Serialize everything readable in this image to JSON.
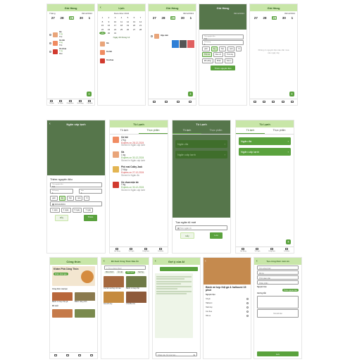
{
  "s1": {
    "title": "Giỏ Hàng",
    "week_label": "Tháng",
    "date": "09/12/2024",
    "days": [
      "27",
      "28",
      "29",
      "30",
      "1"
    ],
    "items": [
      {
        "name": "Gà",
        "qty": "1 kg",
        "note": "Thịt"
      },
      {
        "name": "Cá hồi",
        "qty": "2 kg",
        "note": "Thịt"
      },
      {
        "name": "Cà chua",
        "qty": "1 kg",
        "note": "Rau"
      }
    ],
    "nav": [
      "Tủ lạnh",
      "Tủ Lạnh",
      "Công thức",
      "Giỏ hàng",
      "Cá nhân"
    ],
    "fab": "+"
  },
  "s2": {
    "title": "Lịch",
    "month": "December 2024",
    "cal_days": [
      "1",
      "2",
      "3",
      "4",
      "5",
      "6",
      "7",
      "8",
      "9",
      "10",
      "11",
      "12",
      "13",
      "14",
      "15",
      "16",
      "17",
      "18",
      "19",
      "20",
      "21",
      "22",
      "23",
      "24",
      "25",
      "26",
      "27",
      "28",
      "29",
      "30",
      "31"
    ],
    "selected": "29",
    "sub": "Ngày 29 tháng 12",
    "items": [
      {
        "name": "Gà"
      },
      {
        "name": "Cá hồi"
      },
      {
        "name": "Cà chua"
      }
    ]
  },
  "s3": {
    "title": "Giỏ Hàng",
    "date": "09/12/2024",
    "days": [
      "27",
      "28",
      "29",
      "30",
      "1"
    ],
    "row_label": "Hộp cảm",
    "options": [
      "Hủy",
      "Sửa",
      "Xóa"
    ]
  },
  "s4": {
    "title": "Giỏ Hàng",
    "date": "09/12/2024",
    "fields": [
      {
        "label": "Tên nguyên liệu",
        "value": "Gà"
      },
      {
        "label": "Số lượng",
        "value": "1"
      }
    ],
    "units": [
      "gam",
      "kg",
      "hộp",
      "quả",
      "lít"
    ],
    "tags": [
      "Thịt cá",
      "Rau củ",
      "Trái cây",
      "Đồ uống",
      "Khác",
      "Gia vị"
    ],
    "submit": "Thêm nguyên liệu"
  },
  "s5": {
    "title": "Giỏ Hàng",
    "date": "09/12/2024",
    "days": [
      "27",
      "28",
      "29",
      "30",
      "1"
    ],
    "empty": "Không có nguyên liệu nào cần mua vào ngày này"
  },
  "m1": {
    "title": "Ngăn cấp lạnh",
    "sheet_title": "Thêm nguyên liệu",
    "name_label": "Tên nguyên liệu",
    "name_value": "Gà",
    "qty_label": "Số lượng",
    "qty_value": "1",
    "exp_label": "Hạn",
    "exp_value": "1",
    "units": [
      "gam",
      "kg",
      "hộp",
      "quả",
      "lít"
    ],
    "date": "30/12/2024",
    "quick": [
      "1 ngày",
      "3 ngày",
      "5 ngày",
      "7 ngày"
    ],
    "cancel": "Hủy",
    "ok": "Thêm"
  },
  "m2": {
    "title": "Tủ Lạnh",
    "tabs": [
      "Tủ lạnh",
      "Thực phẩm"
    ],
    "foods": [
      {
        "name": "Cá hồi",
        "qty": "2 Kg",
        "exp": "Expires on 28-12-2024",
        "loc": "Stored in Ngăn cấp lạnh"
      },
      {
        "name": "Gà",
        "qty": "1 kg",
        "exp": "Expires on 30-12-2024",
        "loc": "Stored in Ngăn cấp lạnh"
      },
      {
        "name": "Phô mai Colby Jack",
        "qty": "2 Hộp",
        "exp": "Expires on 27-12-2024",
        "loc": "Stored in Ngăn đá"
      },
      {
        "name": "Cà chua mận bỏ",
        "qty": "1 kg",
        "exp": "Expires on 30-12-2024",
        "loc": "Stored in Ngăn cấp lạnh"
      }
    ],
    "nav": [
      "Giỏ hàng",
      "Tủ Lạnh",
      "Công thức",
      "Cá nhân"
    ]
  },
  "m3": {
    "title": "Tủ Lạnh",
    "tabs": [
      "Tủ lạnh",
      "Thực phẩm"
    ],
    "cards": [
      "Ngăn đá",
      "Ngăn cấp lạnh"
    ],
    "sheet_title": "Tạo ngăn tủ mới",
    "name_placeholder": "Tên ngăn tủ",
    "cancel": "Hủy",
    "ok": "Lưu"
  },
  "m4": {
    "title": "Tủ Lạnh",
    "tabs": [
      "Tủ lạnh",
      "Thực phẩm"
    ],
    "cards": [
      "Ngăn đá",
      "Ngăn cấp lạnh"
    ],
    "fab": "+",
    "nav": [
      "Giỏ hàng",
      "Tủ Lạnh",
      "Công thức",
      "Cá nhân"
    ]
  },
  "b1": {
    "title": "Công thức",
    "banner": "Khám Phá Công Thức",
    "banner_btn": "Khám phá ngay",
    "section1": "Công thức của bạn",
    "cards": [
      {
        "name": "Bánh mì kẹp thịt gà"
      },
      {
        "name": "Bánh xăng nhỏ"
      }
    ],
    "section2": "Đề xuất"
  },
  "b2": {
    "title": "Đề Xuất Công Thức Nấu Ăn",
    "search": "Tìm công thức",
    "pills": [
      "Món chính",
      "Ăn vặt",
      "Cảm lạnh",
      "Nướng"
    ],
    "cards": [
      {
        "name": "Cá hồi nướng với rau"
      },
      {
        "name": "Bánh mì kẹp thịt"
      },
      {
        "name": "Gà sốt cay"
      },
      {
        "name": "Chả Ba Cá"
      }
    ]
  },
  "b3": {
    "title": "Gợi ý của AI",
    "input_placeholder": "Nhập câu hỏi của bạn..."
  },
  "b4": {
    "title": "Bánh mì kẹp thịt gà & halloumi 15 phút",
    "section": "Nguyên liệu",
    "ingredients": [
      "Gà gà",
      "Halloumi",
      "Hành tây",
      "Cà chua",
      "Hồi cá"
    ]
  },
  "b5": {
    "title": "Tạo công thức món ăn",
    "fields": [
      "Tên công thức",
      "Mô tả",
      "Thời gian nấu",
      "Khẩu phần"
    ],
    "section": "Nguyên liệu",
    "add_btn": "Thêm nguyên liệu",
    "steps": "Hướng dẫn",
    "upload": "Tải ảnh lên",
    "save": "Lưu"
  },
  "colors": {
    "primary": "#5aa23d",
    "header": "#c8e6a8",
    "dark_header": "#56764b"
  }
}
